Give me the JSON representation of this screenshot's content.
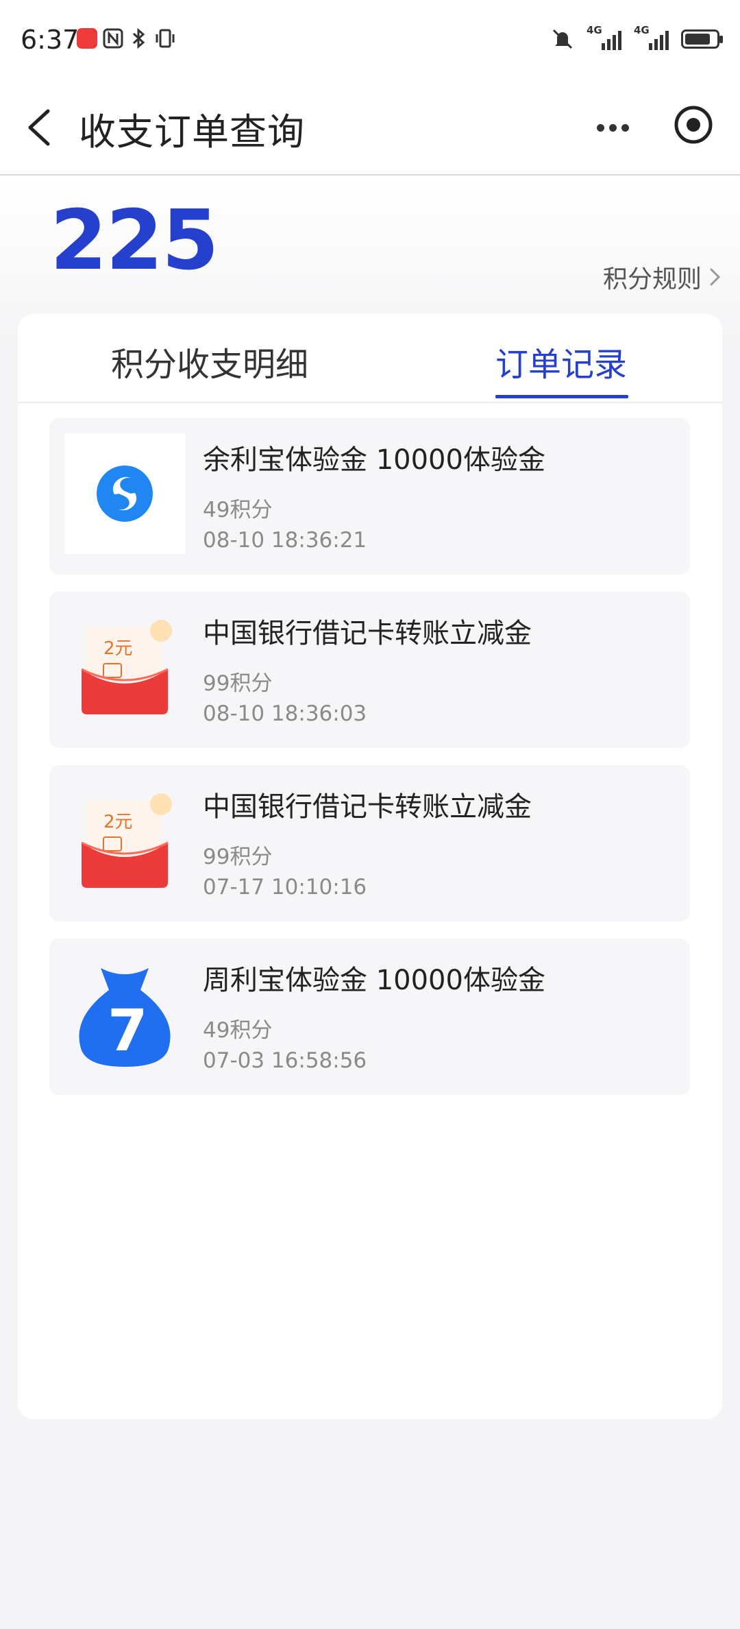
{
  "status_bar": {
    "time": "6:37",
    "left_icons": [
      "app-notification-icon",
      "nfc-icon",
      "bluetooth-icon",
      "vibrate-icon"
    ],
    "right_icons": [
      "mute-icon",
      "signal-4g-icon",
      "signal-4g-icon",
      "battery-charging-icon"
    ],
    "network_label_1": "4G",
    "network_label_2": "4G"
  },
  "nav": {
    "title": "收支订单查询",
    "back_icon": "chevron-left-icon",
    "more_icon": "more-dots-icon",
    "target_icon": "target-icon"
  },
  "points": {
    "value": "225",
    "rules_label": "积分规则"
  },
  "tabs": [
    {
      "label": "积分收支明细",
      "active": false
    },
    {
      "label": "订单记录",
      "active": true
    }
  ],
  "orders": [
    {
      "title": "余利宝体验金 10000体验金",
      "points": "49积分",
      "time": "08-10 18:36:21",
      "icon": "yulibao-logo-icon"
    },
    {
      "title": "中国银行借记卡转账立减金",
      "points": "99积分",
      "time": "08-10 18:36:03",
      "icon": "red-envelope-icon",
      "badge": "2元"
    },
    {
      "title": "中国银行借记卡转账立减金",
      "points": "99积分",
      "time": "07-17 10:10:16",
      "icon": "red-envelope-icon",
      "badge": "2元"
    },
    {
      "title": "周利宝体验金 10000体验金",
      "points": "49积分",
      "time": "07-03 16:58:56",
      "icon": "money-bag-icon",
      "badge": "7"
    }
  ],
  "colors": {
    "accent": "#2440cc",
    "card_bg": "#f6f6f8",
    "page_bg": "#f4f4f6",
    "secondary_text": "#8a8a8a",
    "envelope_red": "#ec3b3b",
    "bag_blue": "#1f6ff0"
  }
}
